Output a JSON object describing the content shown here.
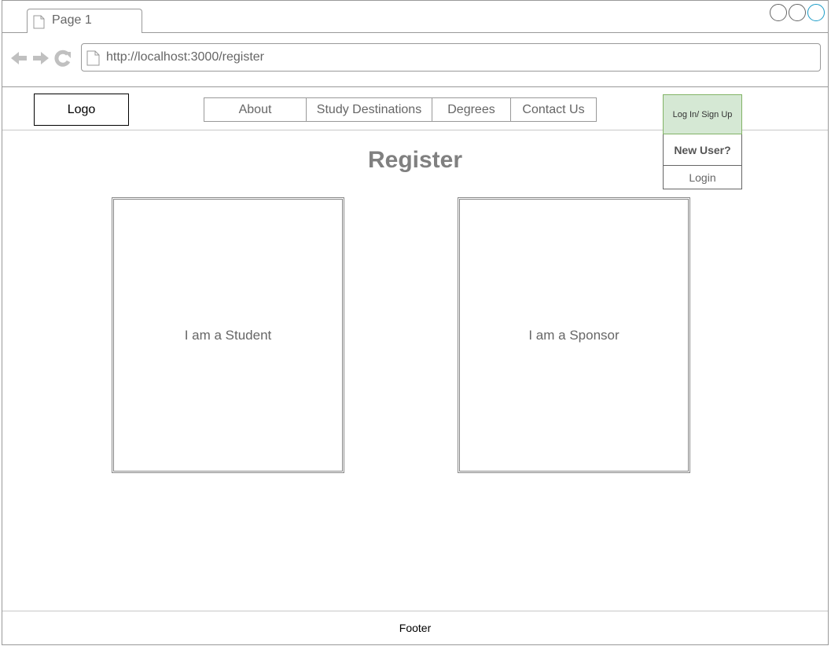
{
  "browser": {
    "tab_label": "Page 1",
    "url": "http://localhost:3000/register",
    "accent_color": "#1a9cc7"
  },
  "header": {
    "logo_label": "Logo",
    "menu": [
      {
        "label": "About"
      },
      {
        "label": "Study Destinations"
      },
      {
        "label": "Degrees"
      },
      {
        "label": "Contact Us"
      }
    ],
    "auth": {
      "main_label": "Log In/ Sign Up",
      "main_color": "#d5e8d4",
      "new_user_label": "New User?",
      "login_label": "Login"
    }
  },
  "main": {
    "title": "Register",
    "cards": {
      "student_label": "I am a Student",
      "sponsor_label": "I am a Sponsor"
    }
  },
  "footer": {
    "label": "Footer"
  }
}
